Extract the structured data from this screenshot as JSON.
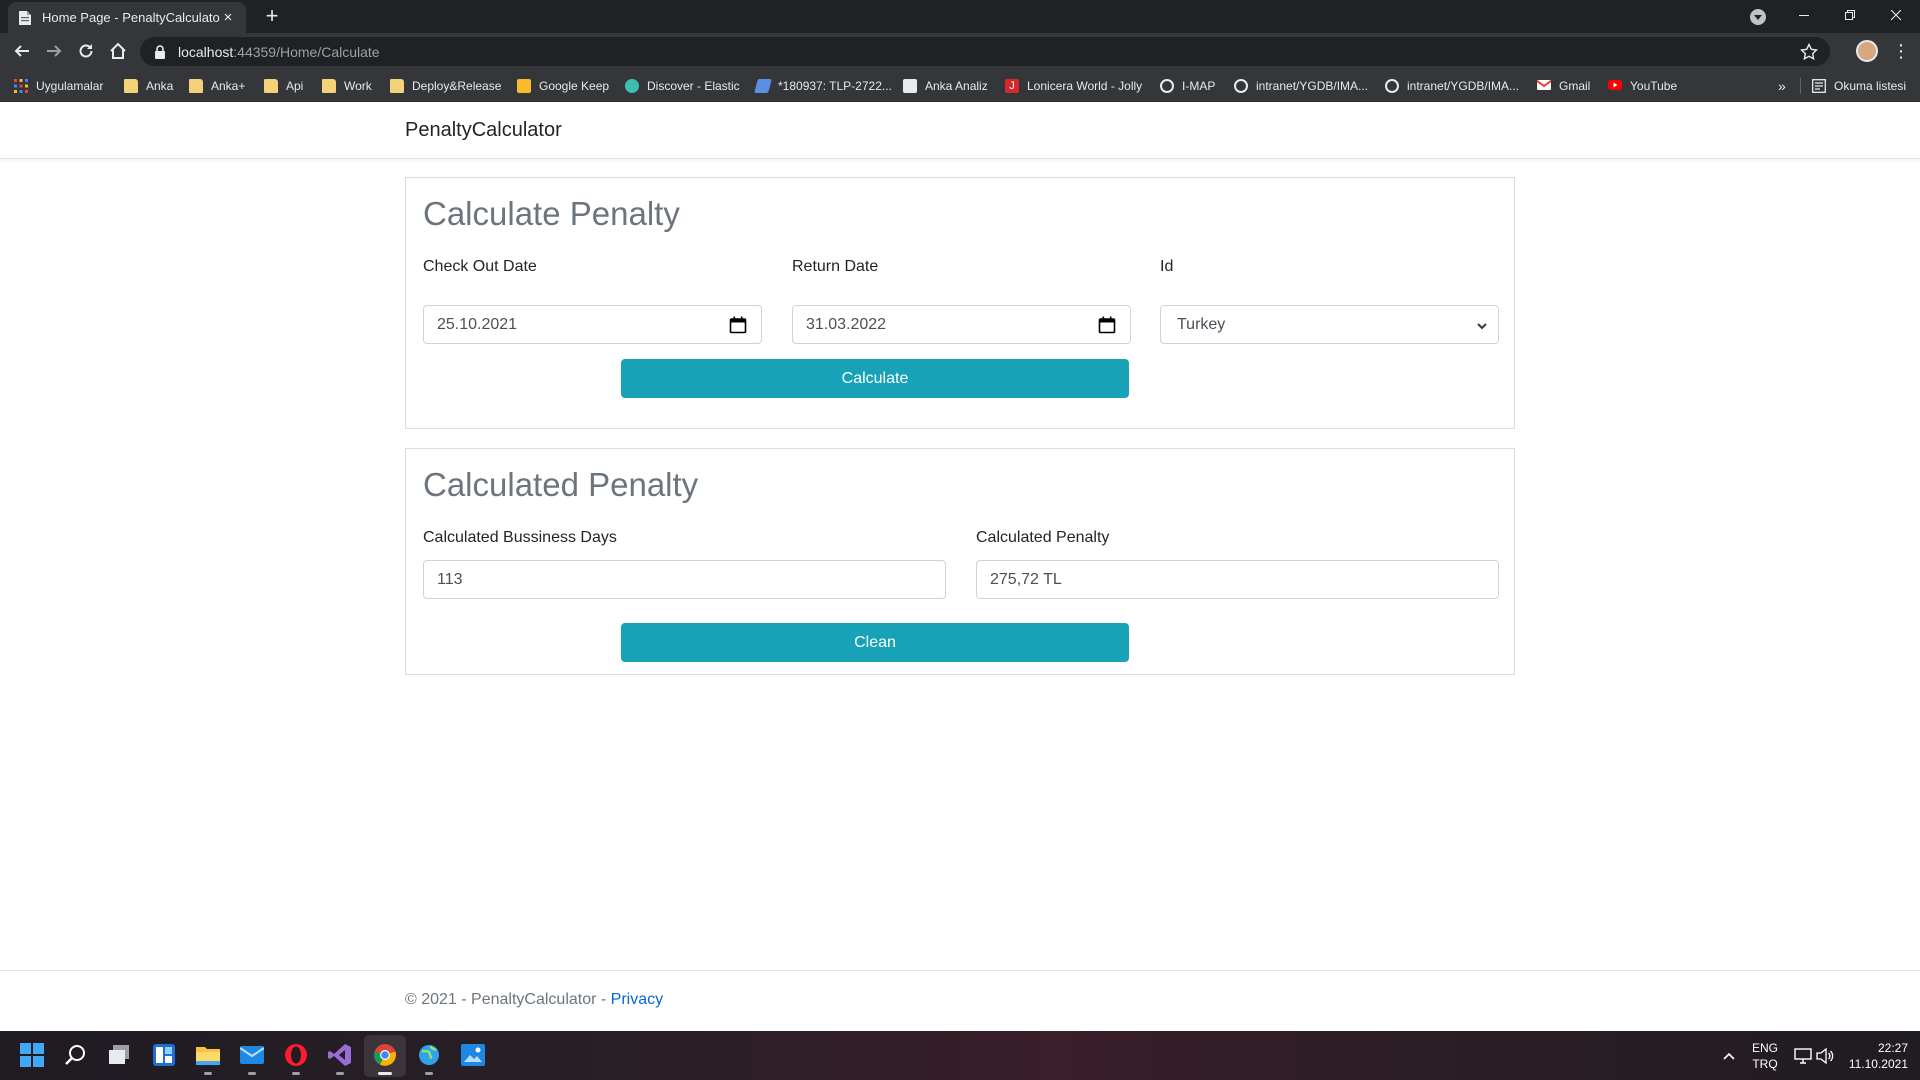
{
  "browser": {
    "tab_title": "Home Page - PenaltyCalculator",
    "tab_close": "×",
    "new_tab": "+",
    "url_host": "localhost",
    "url_path": ":44359/Home/Calculate",
    "bookmarks": [
      {
        "label": "Uygulamalar",
        "icon": "apps-grid-icon"
      },
      {
        "label": "Anka",
        "icon": "folder-icon"
      },
      {
        "label": "Anka+",
        "icon": "folder-icon"
      },
      {
        "label": "Api",
        "icon": "folder-icon"
      },
      {
        "label": "Work",
        "icon": "folder-icon"
      },
      {
        "label": "Deploy&Release",
        "icon": "folder-icon"
      },
      {
        "label": "Google Keep",
        "icon": "google-keep-icon"
      },
      {
        "label": "Discover - Elastic",
        "icon": "elastic-icon"
      },
      {
        "label": "*180937: TLP-2722...",
        "icon": "azure-devops-icon"
      },
      {
        "label": "Anka Analiz",
        "icon": "page-icon"
      },
      {
        "label": "Lonicera World - Jolly",
        "icon": "jolly-icon"
      },
      {
        "label": "I-MAP",
        "icon": "globe-icon"
      },
      {
        "label": "intranet/YGDB/IMA...",
        "icon": "globe-icon"
      },
      {
        "label": "intranet/YGDB/IMA...",
        "icon": "globe-icon"
      },
      {
        "label": "Gmail",
        "icon": "gmail-icon"
      },
      {
        "label": "YouTube",
        "icon": "youtube-icon"
      }
    ],
    "more_bookmarks": "»",
    "reading_list": "Okuma listesi",
    "menu_glyph": "⋮"
  },
  "app": {
    "brand": "PenaltyCalculator",
    "calc_section": {
      "title": "Calculate Penalty",
      "checkout_label": "Check Out Date",
      "checkout_value": "25.10.2021",
      "return_label": "Return Date",
      "return_value": "31.03.2022",
      "id_label": "Id",
      "id_value": "Turkey",
      "calculate_button": "Calculate"
    },
    "result_section": {
      "title": "Calculated Penalty",
      "days_label": "Calculated Bussiness Days",
      "days_value": "113",
      "penalty_label": "Calculated Penalty",
      "penalty_value": "275,72 TL",
      "clean_button": "Clean"
    },
    "footer": {
      "text": "© 2021 - PenaltyCalculator - ",
      "privacy": "Privacy"
    }
  },
  "taskbar": {
    "lang_top": "ENG",
    "lang_bottom": "TRQ",
    "time": "22:27",
    "date": "11.10.2021"
  },
  "colors": {
    "accent": "#17a2b8",
    "link": "#0366d6",
    "heading": "#6c757d"
  }
}
